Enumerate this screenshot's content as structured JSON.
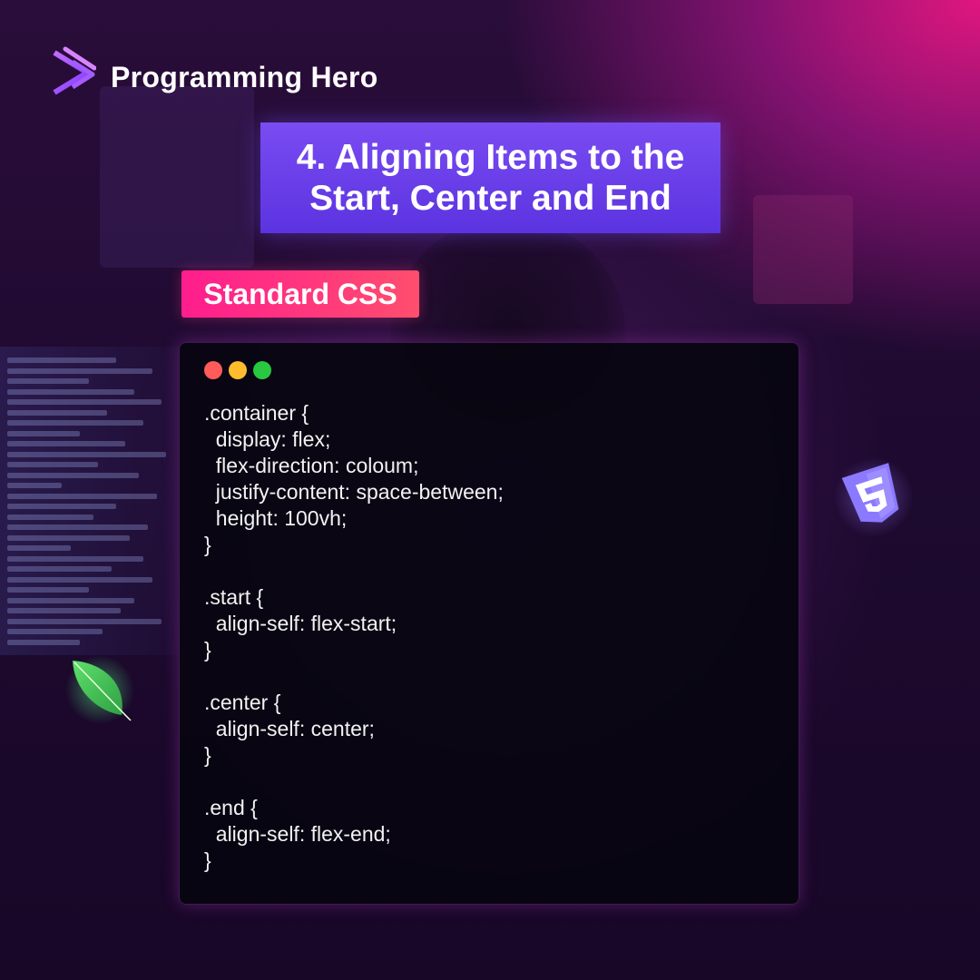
{
  "brand": {
    "name": "Programming Hero",
    "logo_icon": "programming-hero-logo-icon"
  },
  "title": "4. Aligning Items to the\nStart, Center and End",
  "badge": "Standard CSS",
  "window_controls": {
    "close_color": "#ff5b5b",
    "minimize_color": "#ffbd2e",
    "maximize_color": "#28c840"
  },
  "code_lines": [
    ".container {",
    "  display: flex;",
    "  flex-direction: coloum;",
    "  justify-content: space-between;",
    "  height: 100vh;",
    "}",
    "",
    ".start {",
    "  align-self: flex-start;",
    "}",
    "",
    ".center {",
    "  align-self: center;",
    "}",
    "",
    ".end {",
    "  align-self: flex-end;",
    "}"
  ],
  "decorations": {
    "left_icon": "mongodb-leaf-icon",
    "right_icon": "css3-shield-icon"
  },
  "colors": {
    "title_bg": "#6a3ff0",
    "badge_bg": "#ff2f86",
    "accent_pink": "#e0167f"
  }
}
